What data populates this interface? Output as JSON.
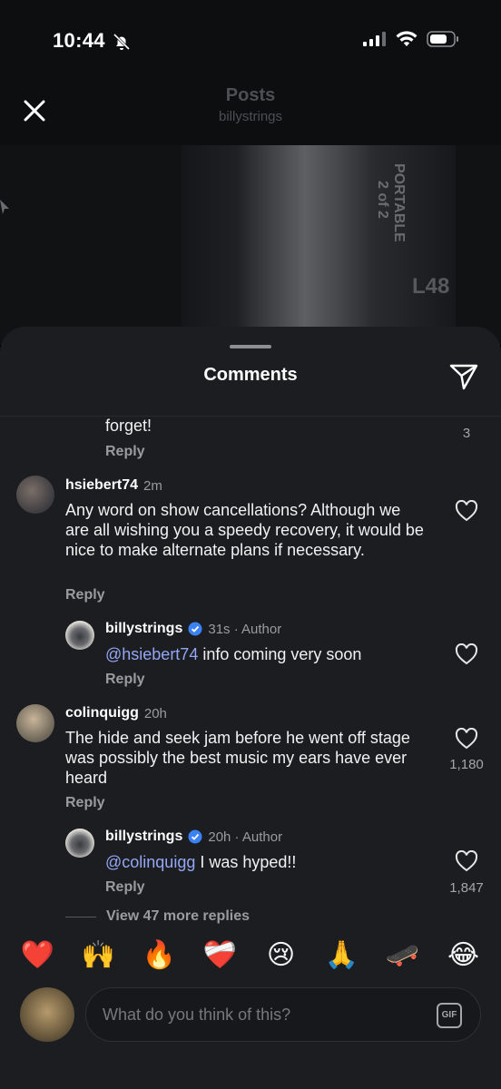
{
  "status_bar": {
    "time": "10:44"
  },
  "header": {
    "title": "Posts",
    "subtitle": "billystrings"
  },
  "post_image": {
    "text_portable": "PORTABLE",
    "text_page": "2 of 2",
    "text_label": "L48"
  },
  "sheet": {
    "title": "Comments"
  },
  "comments": {
    "c0": {
      "text": "forget!",
      "reply": "Reply",
      "likes": "3"
    },
    "c1": {
      "username": "hsiebert74",
      "time": "2m",
      "text": "Any word on show cancellations? Although we are all wishing you a speedy recovery, it would be nice to make alternate plans if necessary.",
      "reply": "Reply"
    },
    "c2": {
      "username": "billystrings",
      "time": "31s · Author",
      "mention": "@hsiebert74",
      "text": " info coming very soon",
      "reply": "Reply"
    },
    "c3": {
      "username": "colinquigg",
      "time": "20h",
      "text": "The hide and seek jam before he went off stage was possibly the best music my ears have ever heard",
      "reply": "Reply",
      "likes": "1,180"
    },
    "c4": {
      "username": "billystrings",
      "time": "20h · Author",
      "mention": "@colinquigg",
      "text": " I was hyped!!",
      "reply": "Reply",
      "likes": "1,847"
    }
  },
  "view_more": "View 47 more replies",
  "emoji_bar": [
    "❤️",
    "🙌",
    "🔥",
    "❤️‍🩹",
    "😢",
    "🙏",
    "🛹",
    "😂"
  ],
  "input": {
    "placeholder": "What do you think of this?",
    "gif_label": "GIF"
  },
  "colors": {
    "sheet_bg": "#1c1d20",
    "mention": "#94a7f5",
    "verified": "#3b82f6"
  }
}
